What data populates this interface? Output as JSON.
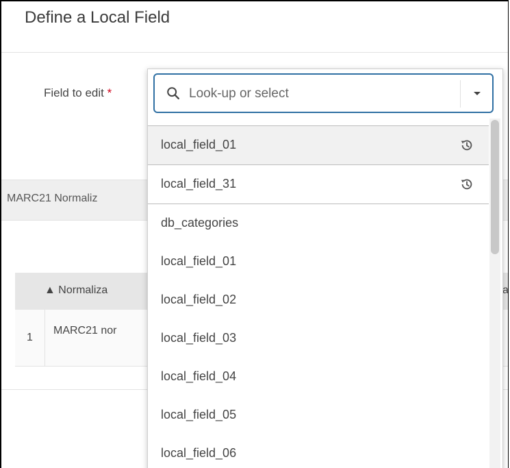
{
  "page": {
    "title": "Define a Local Field"
  },
  "form": {
    "field_label": "Field to edit",
    "required_mark": "*"
  },
  "section": {
    "label": "MARC21 Normaliz"
  },
  "table": {
    "col_normalization": "▲ Normaliza",
    "col_right": "a",
    "rows": [
      {
        "num": "1",
        "name": "MARC21 nor"
      }
    ]
  },
  "dropdown": {
    "search_placeholder": "Look-up or select",
    "recent": [
      "local_field_01",
      "local_field_31"
    ],
    "options": [
      "db_categories",
      "local_field_01",
      "local_field_02",
      "local_field_03",
      "local_field_04",
      "local_field_05",
      "local_field_06"
    ]
  },
  "colors": {
    "accent": "#2f6fa3",
    "required": "#d0021b"
  }
}
